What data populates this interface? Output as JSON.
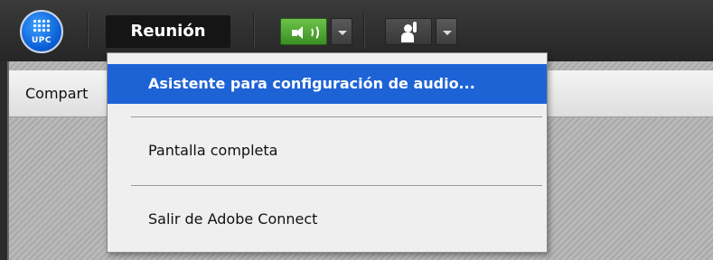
{
  "toolbar": {
    "logo_text": "UPC",
    "meeting_menu_label": "Reunión",
    "audio_icon": "speaker-icon",
    "presenter_icon": "raise-hand-icon"
  },
  "pod": {
    "title": "Compart"
  },
  "menu": {
    "items": [
      {
        "label": "Asistente para configuración de audio...",
        "active": true
      },
      {
        "label": "Pantalla completa",
        "active": false
      },
      {
        "label": "Salir de Adobe Connect",
        "active": false
      }
    ]
  },
  "colors": {
    "highlight": "#1e63d6",
    "audio_green": "#4fae34",
    "toolbar_bg": "#2e2e2e"
  }
}
